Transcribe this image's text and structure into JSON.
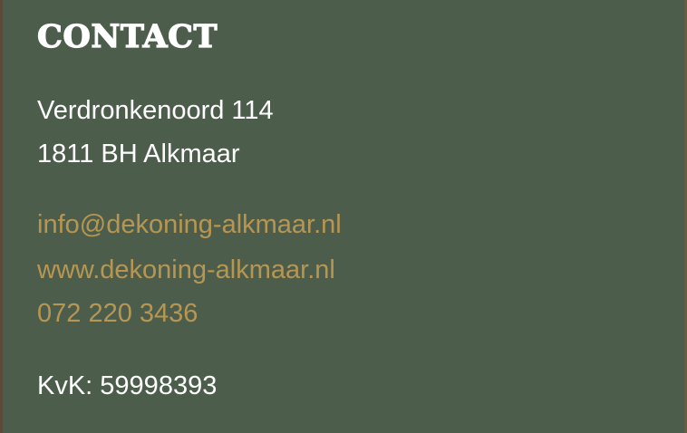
{
  "contact": {
    "title": "CONTACT",
    "address_line1": "Verdronkenoord 114",
    "address_line2": "1811 BH Alkmaar",
    "email": "info@dekoning-alkmaar.nl",
    "website": "www.dekoning-alkmaar.nl",
    "phone": "072 220 3436",
    "kvk": "KvK: 59998393"
  },
  "colors": {
    "background": "#4c5e4b",
    "heading": "#ffffff",
    "text": "#ffffff",
    "link": "#b79653"
  }
}
